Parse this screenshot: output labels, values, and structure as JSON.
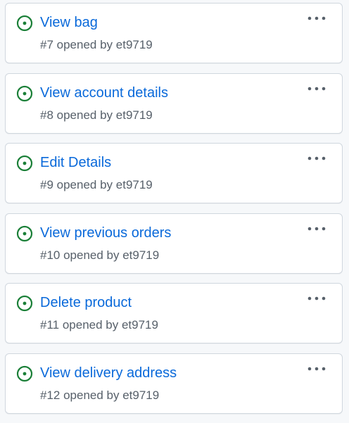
{
  "colors": {
    "open_status": "#1a7f37",
    "link": "#0969da",
    "muted": "#57606a",
    "menu_dots": "#57606a"
  },
  "issues": [
    {
      "title": "View bag",
      "meta": "#7 opened by et9719",
      "status_icon": "issue-opened-icon",
      "menu_icon": "kebab-horizontal-icon"
    },
    {
      "title": "View account details",
      "meta": "#8 opened by et9719",
      "status_icon": "issue-opened-icon",
      "menu_icon": "kebab-horizontal-icon"
    },
    {
      "title": "Edit Details",
      "meta": "#9 opened by et9719",
      "status_icon": "issue-opened-icon",
      "menu_icon": "kebab-horizontal-icon"
    },
    {
      "title": "View previous orders",
      "meta": "#10 opened by et9719",
      "status_icon": "issue-opened-icon",
      "menu_icon": "kebab-horizontal-icon"
    },
    {
      "title": "Delete product",
      "meta": "#11 opened by et9719",
      "status_icon": "issue-opened-icon",
      "menu_icon": "kebab-horizontal-icon"
    },
    {
      "title": "View delivery address",
      "meta": "#12 opened by et9719",
      "status_icon": "issue-opened-icon",
      "menu_icon": "kebab-horizontal-icon"
    }
  ]
}
